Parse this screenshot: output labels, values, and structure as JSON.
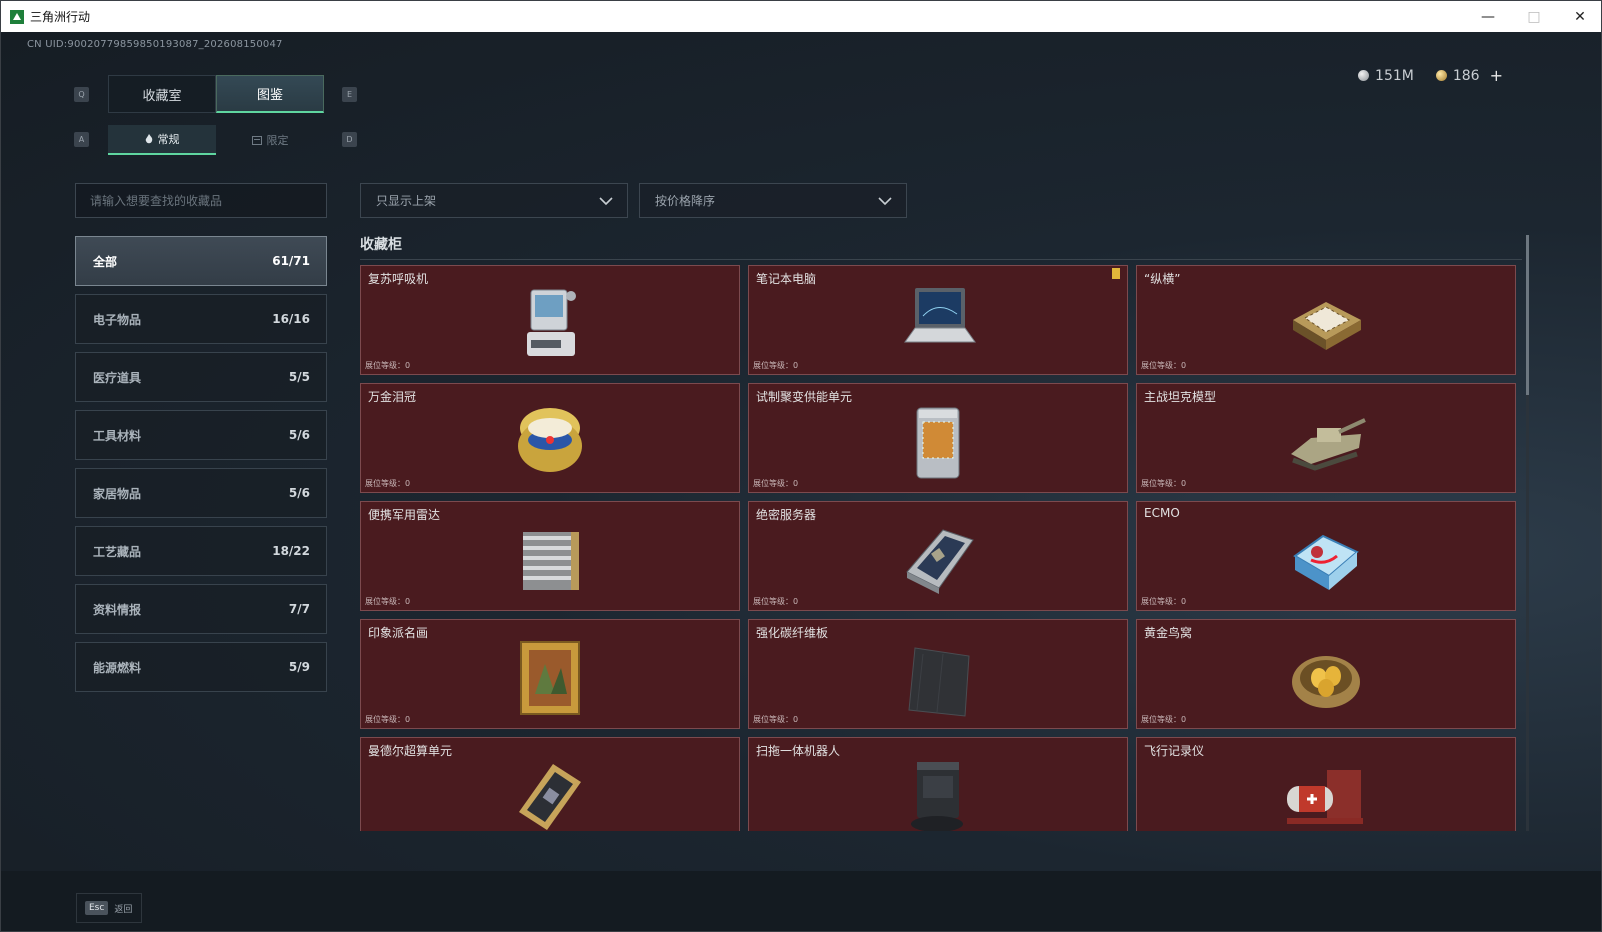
{
  "window": {
    "title": "三角洲行动"
  },
  "uid": "CN UID:9002077985985019308​7_202608150047",
  "currency": {
    "silver": "151M",
    "gold": "186",
    "plus": "+"
  },
  "keys": {
    "q": "Q",
    "e": "E",
    "a": "A",
    "d": "D",
    "esc": "Esc"
  },
  "main_tabs": [
    {
      "label": "收藏室"
    },
    {
      "label": "图鉴"
    }
  ],
  "sub_tabs": [
    {
      "label": "常规"
    },
    {
      "label": "限定"
    }
  ],
  "search": {
    "placeholder": "请输入想要查找的收藏品"
  },
  "filters": [
    {
      "label": "只显示上架"
    },
    {
      "label": "按价格降序"
    }
  ],
  "categories": [
    {
      "label": "全部",
      "count": "61/71"
    },
    {
      "label": "电子物品",
      "count": "16/16"
    },
    {
      "label": "医疗道具",
      "count": "5/5"
    },
    {
      "label": "工具材料",
      "count": "5/6"
    },
    {
      "label": "家居物品",
      "count": "5/6"
    },
    {
      "label": "工艺藏品",
      "count": "18/22"
    },
    {
      "label": "资料情报",
      "count": "7/7"
    },
    {
      "label": "能源燃料",
      "count": "5/9"
    }
  ],
  "section_title": "收藏柜",
  "level_label": "展位等级：0",
  "items": [
    {
      "name": "复苏呼吸机",
      "icon": "ventilator-icon"
    },
    {
      "name": "笔记本电脑",
      "icon": "laptop-icon"
    },
    {
      "name": "“纵横”",
      "icon": "chessboard-icon"
    },
    {
      "name": "万金泪冠",
      "icon": "jeweled-egg-icon"
    },
    {
      "name": "试制聚变供能单元",
      "icon": "fusion-unit-icon"
    },
    {
      "name": "主战坦克模型",
      "icon": "tank-model-icon"
    },
    {
      "name": "便携军用雷达",
      "icon": "radar-icon"
    },
    {
      "name": "绝密服务器",
      "icon": "server-icon"
    },
    {
      "name": "ECMO",
      "icon": "ecmo-icon"
    },
    {
      "name": "印象派名画",
      "icon": "painting-icon"
    },
    {
      "name": "强化碳纤维板",
      "icon": "carbon-plate-icon"
    },
    {
      "name": "黄金鸟窝",
      "icon": "golden-nest-icon"
    },
    {
      "name": "曼德尔超算单元",
      "icon": "supercompute-icon"
    },
    {
      "name": "扫拖一体机器人",
      "icon": "mop-robot-icon"
    },
    {
      "name": "飞行记录仪",
      "icon": "flight-recorder-icon"
    }
  ],
  "footer": {
    "back_label": "返回"
  },
  "colors": {
    "accent": "#5fd6a0",
    "card_bg": "#4a1b1f",
    "card_border": "#7c4a4e"
  }
}
